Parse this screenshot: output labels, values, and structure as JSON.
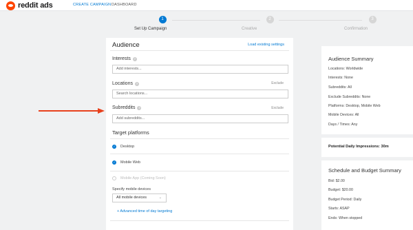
{
  "app": {
    "logo_text": "reddit ads",
    "logo_icon": "reddit-alien-icon"
  },
  "nav": {
    "create_campaign": "CREATE CAMPAIGN",
    "dashboard": "DASHBOARD"
  },
  "steps": [
    {
      "number": "1",
      "label": "Set Up Campaign"
    },
    {
      "number": "2",
      "label": "Creative"
    },
    {
      "number": "3",
      "label": "Confirmation"
    }
  ],
  "audience": {
    "title": "Audience",
    "load_link": "Load existing settings",
    "interests": {
      "label": "Interests",
      "placeholder": "Add interests..."
    },
    "locations": {
      "label": "Locations",
      "exclude": "Exclude",
      "placeholder": "Search locations..."
    },
    "subreddits": {
      "label": "Subreddits",
      "exclude": "Exclude",
      "placeholder": "Add subreddits..."
    }
  },
  "platforms": {
    "title": "Target platforms",
    "desktop": "Desktop",
    "mobile_web": "Mobile Web",
    "mobile_app": "Mobile App (Coming Soon)",
    "devices_label": "Specify mobile devices",
    "devices_value": "All mobile devices",
    "advanced_link": "+ Advanced time of day targeting"
  },
  "summary": {
    "title": "Audience Summary",
    "lines": [
      "Locations: Worldwide",
      "Interests: None",
      "Subreddits: All",
      "Exclude Subreddits: None",
      "Platforms: Desktop, Mobile Web",
      "Mobile Devices: All",
      "Days / Times: Any"
    ]
  },
  "impressions": {
    "text": "Potential Daily Impressions: 30m"
  },
  "budget": {
    "title": "Schedule and Budget Summary",
    "lines": [
      "Bid: $2.00",
      "Budget: $20.00",
      "Budget Period: Daily",
      "Starts: ASAP",
      "Ends: When stopped"
    ]
  },
  "colors": {
    "accent": "#0079d3",
    "brand": "#ff4500",
    "arrow": "#e8401c"
  }
}
